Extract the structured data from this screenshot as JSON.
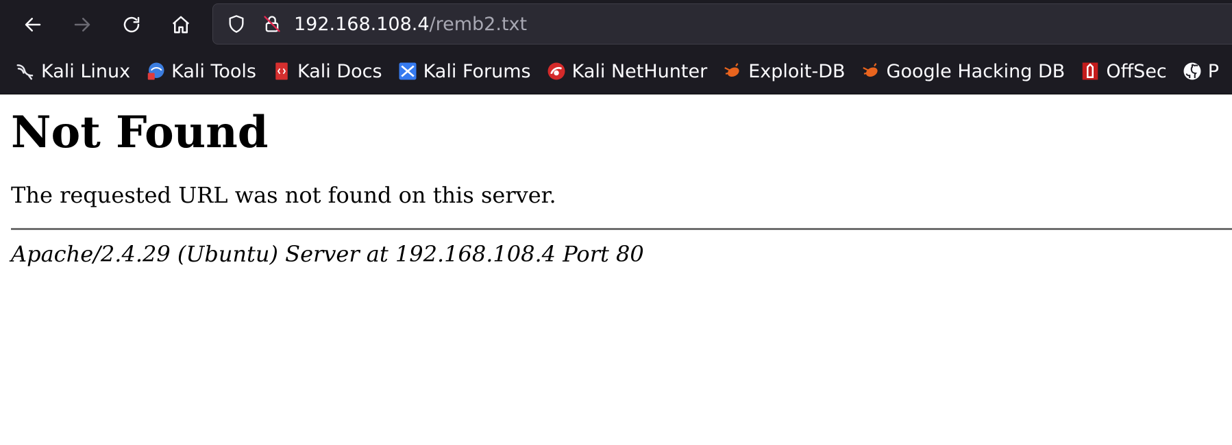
{
  "browser": {
    "url_host": "192.168.108.4",
    "url_path": "/remb2.txt"
  },
  "bookmarks": [
    {
      "label": "Kali Linux",
      "icon": "kali-dragon-icon"
    },
    {
      "label": "Kali Tools",
      "icon": "kali-tools-icon"
    },
    {
      "label": "Kali Docs",
      "icon": "kali-docs-icon"
    },
    {
      "label": "Kali Forums",
      "icon": "kali-forums-icon"
    },
    {
      "label": "Kali NetHunter",
      "icon": "kali-nethunter-icon"
    },
    {
      "label": "Exploit-DB",
      "icon": "exploit-db-icon"
    },
    {
      "label": "Google Hacking DB",
      "icon": "google-hacking-db-icon"
    },
    {
      "label": "OffSec",
      "icon": "offsec-icon"
    },
    {
      "label": "P",
      "icon": "github-icon"
    }
  ],
  "page": {
    "heading": "Not Found",
    "message": "The requested URL was not found on this server.",
    "server_signature": "Apache/2.4.29 (Ubuntu) Server at 192.168.108.4 Port 80"
  },
  "colors": {
    "chrome_bg": "#1c1b22",
    "urlbar_bg": "#2b2a33",
    "chrome_text": "#fbfbfe",
    "url_path_text": "#a8a8b3",
    "page_bg": "#ffffff"
  }
}
